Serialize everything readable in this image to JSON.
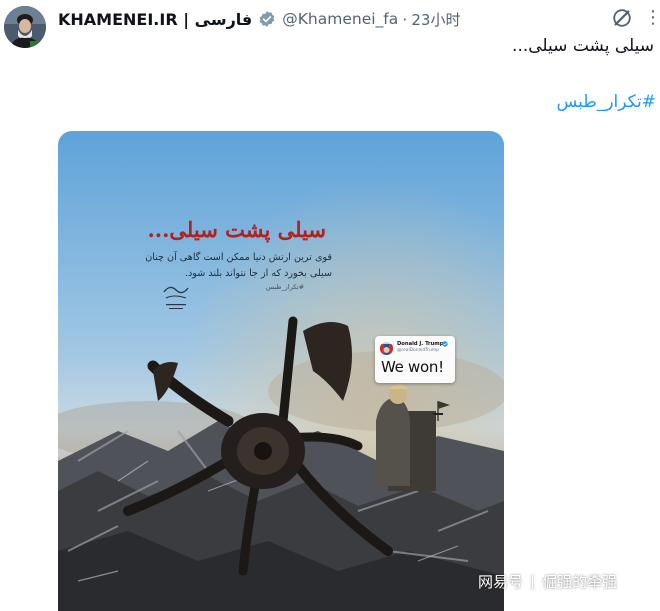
{
  "tweet": {
    "display_name": "KHAMENEI.IR | فارسی",
    "handle": "@Khamenei_fa",
    "separator_dot": "·",
    "time": "23小时",
    "text": "سیلی پشت سیلی...",
    "hashtag": "#تکرار_طبس",
    "more_icon": "more-icon",
    "link_color": "#1d9bf0"
  },
  "poster": {
    "title": "سیلی پشت سیلی...",
    "body_lines": [
      "قوی ترین ارتش دنیا ممکن است گاهی آن چنان",
      "سیلی بخورد که از جا نتواند بلند شود."
    ],
    "hashtag": "#تکرار_طبس",
    "title_color": "#b0211f"
  },
  "trump_card": {
    "name": "Donald J. Trump",
    "handle": "@realDonaldTrump",
    "text": "We won!"
  },
  "watermark": {
    "platform": "网易号",
    "separator": "|",
    "author": "倔强的牵强"
  }
}
